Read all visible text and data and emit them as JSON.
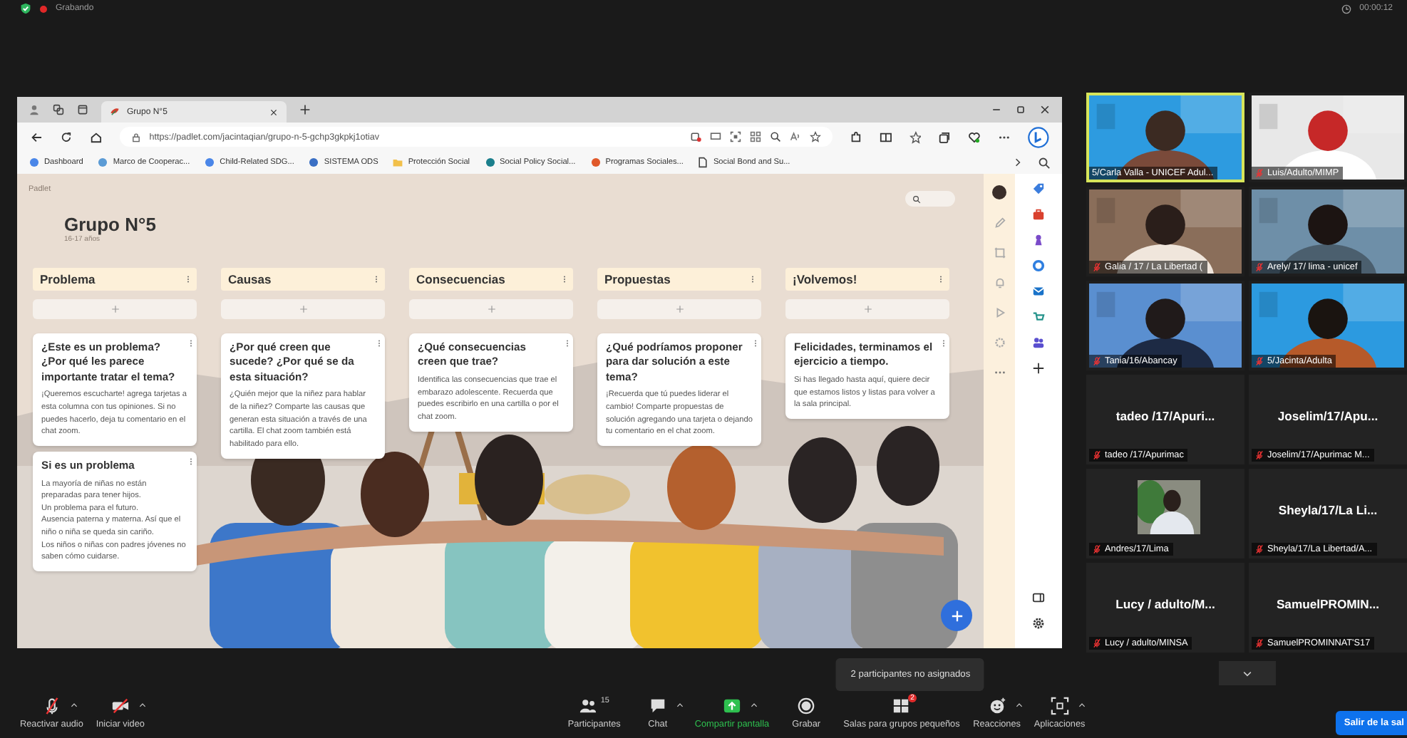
{
  "meeting": {
    "recording_label": "Grabando",
    "timer": "00:00:12"
  },
  "browser": {
    "tab_title": "Grupo N°5",
    "url": "https://padlet.com/jacintaqian/grupo-n-5-gchp3gkpkj1otiav",
    "bookmarks": [
      "Dashboard",
      "Marco de Cooperac...",
      "Child-Related SDG...",
      "SISTEMA ODS",
      "Protección Social",
      "Social Policy Social...",
      "Programas Sociales...",
      "Social Bond and Su..."
    ]
  },
  "padlet": {
    "brand": "Padlet",
    "title": "Grupo N°5",
    "subtitle": "16-17 años",
    "columns": [
      {
        "title": "Problema",
        "cards": [
          {
            "title": "¿Este es un problema? ¿Por qué les parece importante tratar el tema?",
            "body": "¡Queremos escucharte! agrega tarjetas a esta columna con tus opiniones. Si no puedes hacerlo, deja tu comentario en el chat zoom."
          },
          {
            "title": "Si es un problema",
            "body": "La mayoría de niñas no están preparadas para tener hijos.\nUn problema para el futuro.\nAusencia paterna y materna. Así que el niño o niña se queda sin cariño.\nLos niños o niñas con padres jóvenes no saben cómo cuidarse."
          }
        ]
      },
      {
        "title": "Causas",
        "cards": [
          {
            "title": "¿Por qué creen que sucede? ¿Por qué se da esta situación?",
            "body": "¿Quién mejor que la niñez para hablar de la niñez? Comparte las causas que generan esta situación a través de una cartilla. El chat zoom también está habilitado para ello."
          }
        ]
      },
      {
        "title": "Consecuencias",
        "cards": [
          {
            "title": "¿Qué consecuencias creen que trae?",
            "body": "Identifica las consecuencias que trae el embarazo adolescente. Recuerda que puedes escribirlo en una cartilla o por el chat zoom."
          }
        ]
      },
      {
        "title": "Propuestas",
        "cards": [
          {
            "title": "¿Qué podríamos proponer para dar solución a este tema?",
            "body": "¡Recuerda que tú puedes liderar el cambio! Comparte propuestas de solución agregando una tarjeta o dejando tu comentario en el chat zoom."
          }
        ]
      },
      {
        "title": "¡Volvemos!",
        "cards": [
          {
            "title": "Felicidades, terminamos el ejercicio a tiempo.",
            "body": "Si has llegado hasta aquí, quiere decir que estamos listos y listas para volver a la sala principal."
          }
        ]
      }
    ]
  },
  "participants": [
    {
      "kind": "video",
      "label": "5/Carla Valla - UNICEF Adul...",
      "muted": false,
      "speaking": true
    },
    {
      "kind": "video",
      "label": "Luis/Adulto/MIMP",
      "muted": true,
      "speaking": false
    },
    {
      "kind": "video",
      "label": "Galia / 17 / La Libertad (",
      "muted": true,
      "speaking": false
    },
    {
      "kind": "video",
      "label": "Arely/ 17/ lima - unicef",
      "muted": true,
      "speaking": false
    },
    {
      "kind": "video",
      "label": "Tania/16/Abancay",
      "muted": true,
      "speaking": false
    },
    {
      "kind": "video",
      "label": "5/Jacinta/Adulta",
      "muted": true,
      "speaking": false
    },
    {
      "kind": "name",
      "display_name": "tadeo /17/Apuri...",
      "label": "tadeo /17/Apurimac",
      "muted": true,
      "speaking": false
    },
    {
      "kind": "name",
      "display_name": "Joselim/17/Apu...",
      "label": "Joselim/17/Apurimac M...",
      "muted": true,
      "speaking": false
    },
    {
      "kind": "avatar",
      "label": "Andres/17/Lima",
      "muted": true,
      "speaking": false
    },
    {
      "kind": "name",
      "display_name": "Sheyla/17/La Li...",
      "label": "Sheyla/17/La Libertad/A...",
      "muted": true,
      "speaking": false
    },
    {
      "kind": "name",
      "display_name": "Lucy / adulto/M...",
      "label": "Lucy / adulto/MINSA",
      "muted": true,
      "speaking": false
    },
    {
      "kind": "name",
      "display_name": "SamuelPROMIN...",
      "label": "SamuelPROMINNAT'S17",
      "muted": true,
      "speaking": false
    }
  ],
  "toolbar": {
    "items": [
      {
        "kind": "mic_off",
        "label": "Reactivar audio",
        "menu": true
      },
      {
        "kind": "video_off",
        "label": "Iniciar video",
        "menu": true
      },
      {
        "kind": "participants",
        "label": "Participantes",
        "count": "15",
        "menu": false
      },
      {
        "kind": "chat",
        "label": "Chat",
        "menu": true
      },
      {
        "kind": "share",
        "label": "Compartir pantalla",
        "menu": true
      },
      {
        "kind": "record",
        "label": "Grabar",
        "menu": false
      },
      {
        "kind": "breakout",
        "label": "Salas para grupos pequeños",
        "badge": "2",
        "tooltip": "2 participantes no asignados",
        "menu": false
      },
      {
        "kind": "reactions",
        "label": "Reacciones",
        "menu": true
      },
      {
        "kind": "apps",
        "label": "Aplicaciones",
        "menu": true
      }
    ],
    "leave_button": "Salir de la sal"
  }
}
